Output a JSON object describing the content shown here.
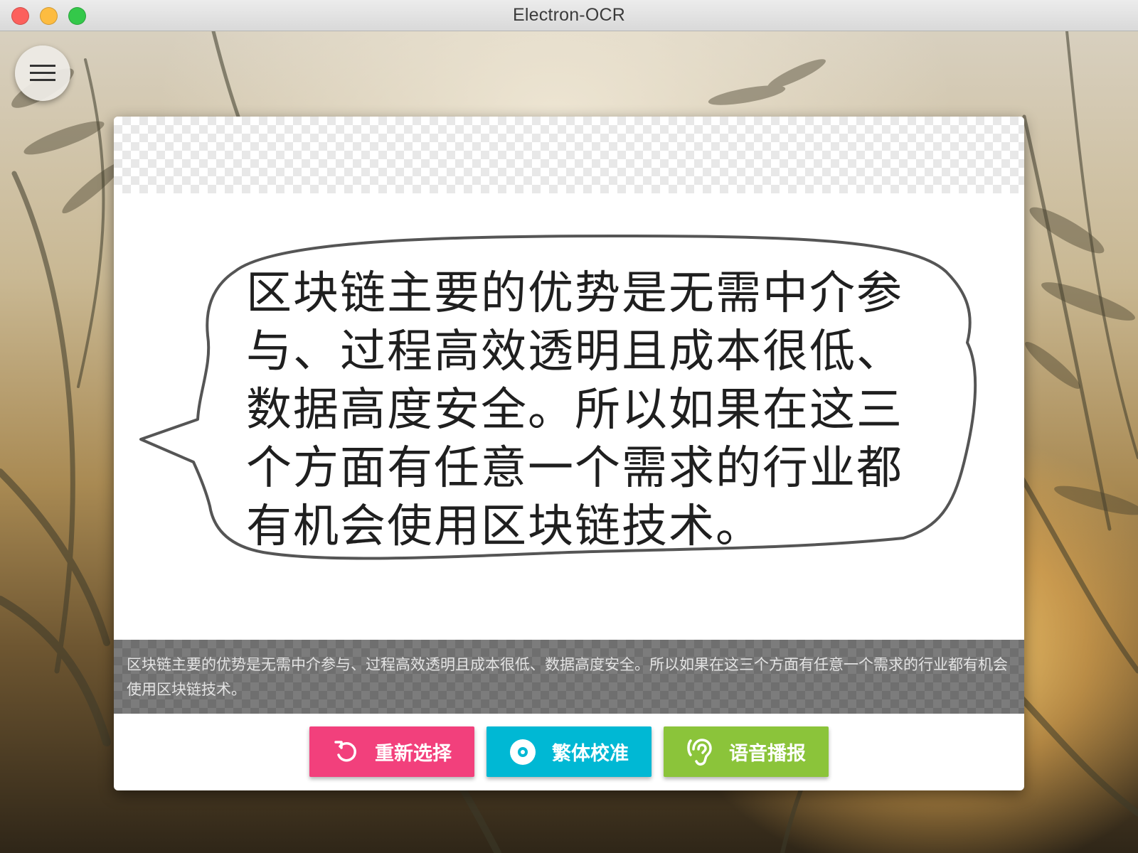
{
  "window": {
    "title": "Electron-OCR"
  },
  "source_image": {
    "bubble_text": "区块链主要的优势是无需中介参与、过程高效透明且成本很低、数据高度安全。所以如果在这三个方面有任意一个需求的行业都有机会使用区块链技术。"
  },
  "ocr_result": {
    "text": "区块链主要的优势是无需中介参与、过程高效透明且成本很低、数据高度安全。所以如果在这三个方面有任意一个需求的行业都有机会使用区块链技术。"
  },
  "actions": {
    "reselect_label": "重新选择",
    "traditional_label": "繁体校准",
    "speech_label": "语音播报"
  },
  "colors": {
    "reselect": "#f2407c",
    "traditional": "#00b8d4",
    "speech": "#8bc43a"
  },
  "icons": {
    "menu": "hamburger-icon",
    "reselect": "rotate-left-icon",
    "traditional": "disc-icon",
    "speech": "hearing-icon"
  }
}
